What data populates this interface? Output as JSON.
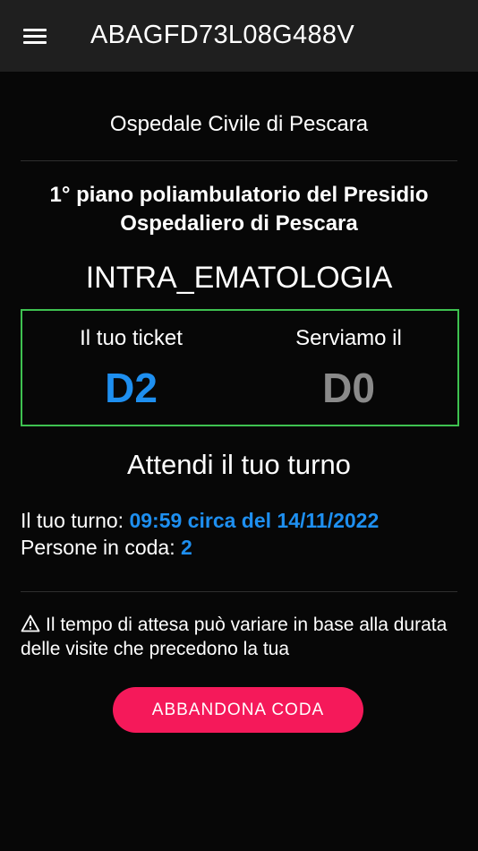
{
  "header": {
    "title": "ABAGFD73L08G488V",
    "menu_icon": "hamburger-menu-icon"
  },
  "hospital_name": "Ospedale Civile di Pescara",
  "location": "1° piano poliambulatorio del Presidio Ospedaliero di Pescara",
  "service": "INTRA_EMATOLOGIA",
  "ticket": {
    "your_ticket_label": "Il tuo ticket",
    "your_ticket_value": "D2",
    "serving_label": "Serviamo il",
    "serving_value": "D0"
  },
  "wait_message": "Attendi il tuo turno",
  "turn": {
    "label": "Il tuo turno: ",
    "value": "09:59 circa del 14/11/2022"
  },
  "queue": {
    "label": "Persone in coda: ",
    "value": "2"
  },
  "warning": {
    "icon": "warning-triangle-icon",
    "text": "Il tempo di attesa può variare in base alla durata delle visite che precedono la tua"
  },
  "abandon_button_label": "ABBANDONA CODA",
  "colors": {
    "accent_blue": "#1e8ff0",
    "serving_gray": "#8a8a8a",
    "ticket_border_green": "#3ec150",
    "button_pink": "#f5195a",
    "topbar_bg": "#1f1f1f",
    "page_bg": "#070707"
  }
}
